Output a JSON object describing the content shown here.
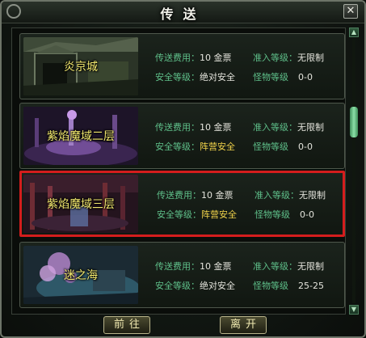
{
  "window": {
    "title": "传送",
    "close_glyph": "✕"
  },
  "labels": {
    "cost": "传送费用：",
    "level": "准入等级：",
    "safety": "安全等级：",
    "monster": "怪物等级"
  },
  "destinations": [
    {
      "name": "炎京城",
      "cost": "10 金票",
      "level": "无限制",
      "safety": "绝对安全",
      "safety_type": "absolute",
      "monster": "0-0",
      "selected": false
    },
    {
      "name": "紫焰魔域二层",
      "cost": "10 金票",
      "level": "无限制",
      "safety": "阵营安全",
      "safety_type": "camp",
      "monster": "0-0",
      "selected": false
    },
    {
      "name": "紫焰魔域三层",
      "cost": "10 金票",
      "level": "无限制",
      "safety": "阵营安全",
      "safety_type": "camp",
      "monster": "0-0",
      "selected": true
    },
    {
      "name": "迷之海",
      "cost": "10 金票",
      "level": "无限制",
      "safety": "绝对安全",
      "safety_type": "absolute",
      "monster": "25-25",
      "selected": false
    }
  ],
  "buttons": {
    "go": "前往",
    "leave": "离开"
  },
  "scroll": {
    "up_icon": "triangle-up-icon",
    "down_icon": "triangle-down-icon",
    "up_glyph": "▲",
    "down_glyph": "▼"
  },
  "colors": {
    "selection_border": "#d41d1d",
    "label_green": "#5fc08a",
    "camp_yellow": "#f0d24a",
    "name_yellow": "#f1e86e"
  }
}
